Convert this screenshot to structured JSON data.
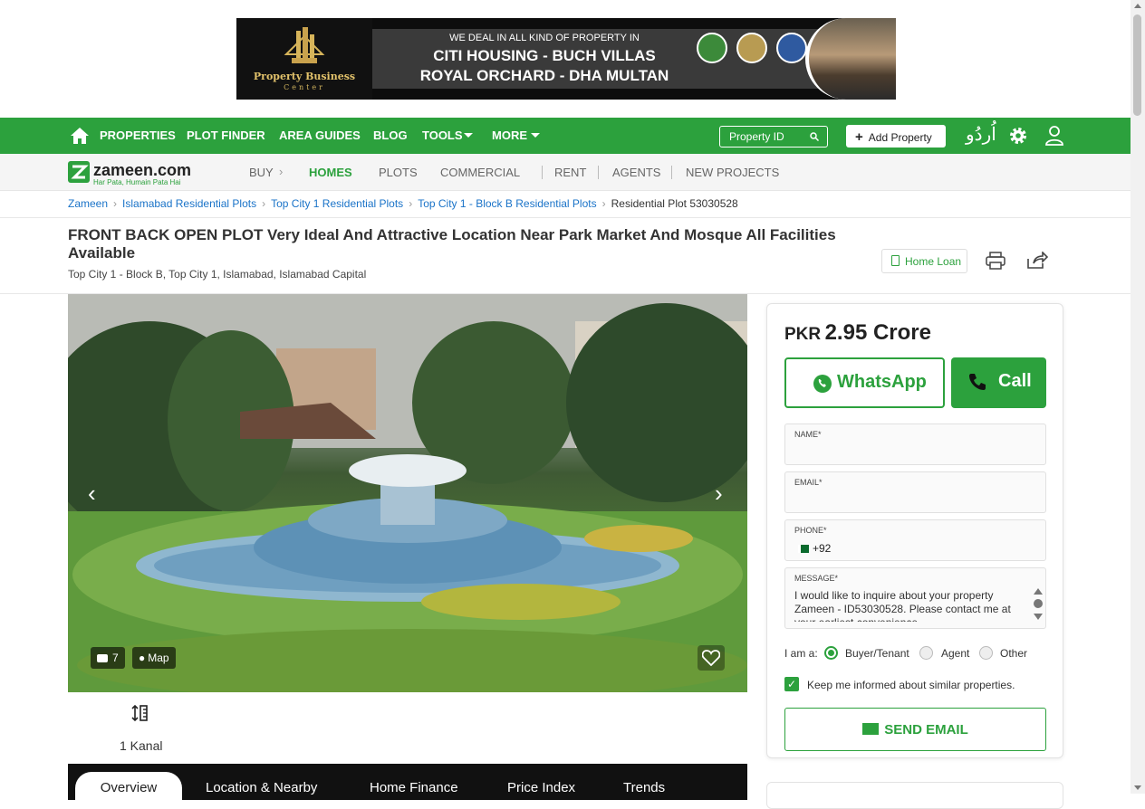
{
  "ad": {
    "logo_name": "Property Business",
    "logo_sub": "Center",
    "line1": "WE DEAL IN ALL KIND OF PROPERTY IN",
    "line2": "CITI HOUSING - BUCH VILLAS",
    "line3": "ROYAL ORCHARD - DHA MULTAN"
  },
  "topnav": {
    "items": [
      "PROPERTIES",
      "PLOT FINDER",
      "AREA GUIDES",
      "BLOG",
      "TOOLS",
      "MORE"
    ],
    "property_id_placeholder": "Property ID",
    "add_property": "Add Property",
    "urdu": "اُردُو",
    "colors": {
      "brand_green": "#2ca13d"
    }
  },
  "subnav": {
    "brand": "zameen.com",
    "tagline": "Har Pata, Humain Pata Hai",
    "buy": "BUY",
    "homes": "HOMES",
    "plots": "PLOTS",
    "commercial": "COMMERCIAL",
    "rent": "RENT",
    "agents": "AGENTS",
    "new_projects": "NEW PROJECTS"
  },
  "breadcrumb": [
    "Zameen",
    "Islamabad Residential Plots",
    "Top City 1 Residential Plots",
    "Top City 1 - Block B Residential Plots",
    "Residential Plot 53030528"
  ],
  "listing": {
    "title": "FRONT BACK OPEN PLOT Very Ideal And Attractive Location Near Park Market And Mosque All Facilities Available",
    "location": "Top City 1 - Block B, Top City 1, Islamabad, Islamabad Capital",
    "home_loan": "Home Loan",
    "photo_count": "7",
    "map_label": "Map",
    "area": "1 Kanal"
  },
  "tabs": [
    "Overview",
    "Location & Nearby",
    "Home Finance",
    "Price Index",
    "Trends"
  ],
  "contact": {
    "currency": "PKR",
    "price": "2.95 Crore",
    "whatsapp": "WhatsApp",
    "call": "Call",
    "name_label": "NAME*",
    "email_label": "EMAIL*",
    "phone_label": "PHONE*",
    "phone_code": "+92",
    "message_label": "MESSAGE*",
    "message": "I would like to inquire about your property Zameen - ID53030528. Please contact me at your earliest convenience.",
    "iam_label": "I am a:",
    "roles": [
      "Buyer/Tenant",
      "Agent",
      "Other"
    ],
    "selected_role": "Buyer/Tenant",
    "keep_informed": "Keep me informed about similar properties.",
    "send_email": "SEND EMAIL"
  }
}
